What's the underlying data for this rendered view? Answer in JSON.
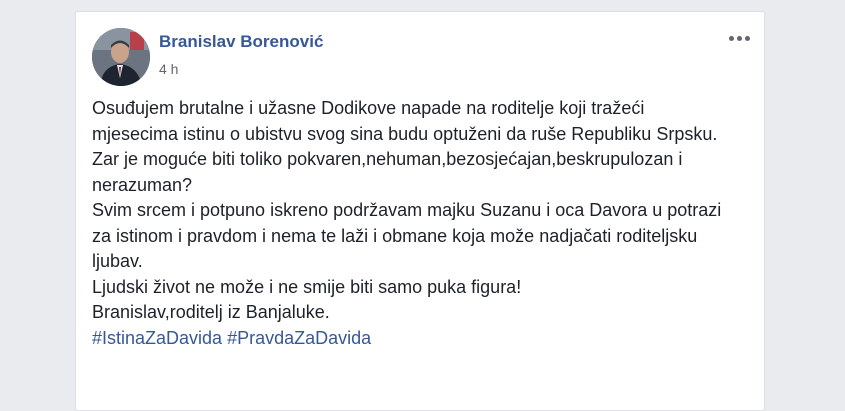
{
  "post": {
    "author": "Branislav Borenović",
    "time": "4 h",
    "more_icon": "ellipsis-icon",
    "paragraphs": [
      "Osuđujem brutalne i užasne Dodikove napade na roditelje koji tražeći mjesecima istinu o ubistvu svog sina budu optuženi da ruše Republiku Srpsku.",
      "Zar je moguće biti toliko pokvaren,nehuman,bezosjećajan,beskrupulozan i nerazuman?",
      "Svim srcem i potpuno iskreno podržavam majku Suzanu i oca Davora u potrazi za istinom i pravdom i nema te laži i obmane koja može nadjačati roditeljsku ljubav.",
      "Ljudski život ne može i ne smije biti samo puka figura!",
      "Branislav,roditelj iz Banjaluke."
    ],
    "hashtags": [
      "#IstinaZaDavida",
      "#PravdaZaDavida"
    ]
  },
  "colors": {
    "background": "#e9ebee",
    "card": "#ffffff",
    "link": "#365899",
    "text": "#1d2129",
    "meta": "#616770"
  }
}
